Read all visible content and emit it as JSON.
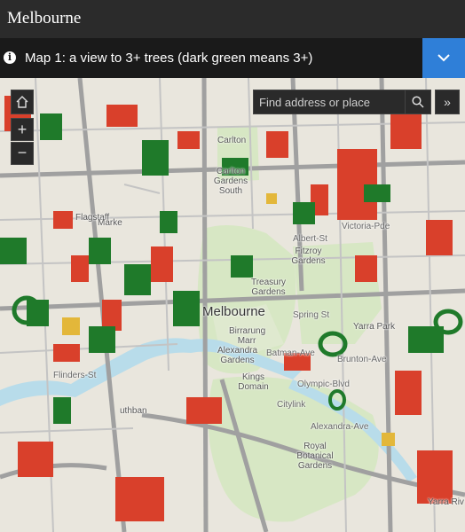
{
  "app": {
    "title": "Melbourne"
  },
  "info_bar": {
    "caption": "Map 1: a view to 3+ trees (dark green means 3+)"
  },
  "search": {
    "placeholder": "Find address or place"
  },
  "controls": {
    "zoom_in": "+",
    "zoom_out": "−",
    "collapse": "»"
  },
  "map_labels": {
    "melbourne": "Melbourne",
    "carlton": "Carlton",
    "carlton_gardens": "Carlton Gardens South",
    "fitzroy_gardens": "Fitzroy Gardens",
    "treasury_gardens": "Treasury Gardens",
    "yarra_park": "Yarra Park",
    "birrarung_marr": "Birrarung Marr",
    "alexandra_gardens": "Alexandra Gardens",
    "kings_domain": "Kings Domain",
    "royal_botanical_gardens": "Royal Botanical Gardens",
    "citylink": "Citylink",
    "olympic_blvd": "Olympic-Blvd",
    "brunton_ave": "Brunton-Ave",
    "batman_ave": "Batman-Ave",
    "alexandra_ave": "Alexandra-Ave",
    "flinders_st": "Flinders-St",
    "victoria_pde": "Victoria-Pde",
    "albert_st": "Albert-St",
    "flagstaff": "Flagstaff",
    "spring_st": "Spring St",
    "yarra_riv": "Yarra Riv",
    "southbank": "uthban",
    "marke": "Marke"
  },
  "colors": {
    "tree_3plus": "#1f7a2a",
    "tree_few": "#d9402b",
    "tree_mid": "#e3b73a",
    "park": "#d7e7c4",
    "water": "#b8dcea",
    "road": "#9b9b9b",
    "accent": "#2f7fd8"
  }
}
